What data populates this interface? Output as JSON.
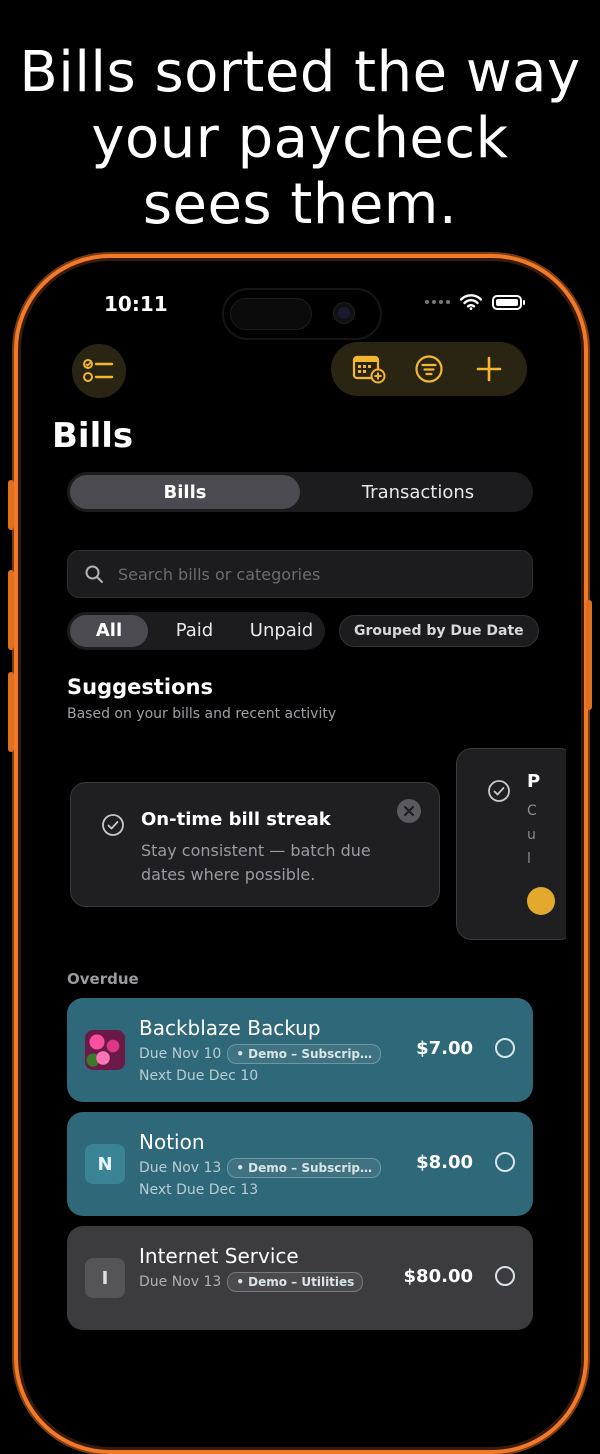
{
  "headline": [
    "Bills sorted the way",
    "your paycheck",
    "sees them."
  ],
  "status": {
    "time": "10:11"
  },
  "page": {
    "title": "Bills"
  },
  "tabs": [
    {
      "label": "Bills",
      "active": true
    },
    {
      "label": "Transactions",
      "active": false
    }
  ],
  "search": {
    "placeholder": "Search bills or categories"
  },
  "filters": [
    {
      "label": "All",
      "active": true
    },
    {
      "label": "Paid",
      "active": false
    },
    {
      "label": "Unpaid",
      "active": false
    }
  ],
  "grouping": {
    "label": "Grouped by Due Date"
  },
  "suggestions": {
    "title": "Suggestions",
    "subtitle": "Based on your bills and recent activity",
    "cards": [
      {
        "title": "On-time bill streak",
        "body": "Stay consistent — batch due dates where possible."
      },
      {
        "title": "P",
        "body_fragments": [
          "C",
          "u",
          "l"
        ]
      }
    ]
  },
  "sections": [
    {
      "label": "Overdue",
      "bills": [
        {
          "name": "Backblaze Backup",
          "due": "Due Nov 10",
          "tag": "• Demo – Subscripti...",
          "next": "Next Due Dec 10",
          "amount": "$7.00",
          "initial": "",
          "style": "teal"
        },
        {
          "name": "Notion",
          "due": "Due Nov 13",
          "tag": "• Demo – Subscriptio...",
          "next": "Next Due Dec 13",
          "amount": "$8.00",
          "initial": "N",
          "style": "teal"
        },
        {
          "name": "Internet Service",
          "due": "Due Nov 13",
          "tag": "• Demo – Utilities",
          "next": "",
          "amount": "$80.00",
          "initial": "I",
          "style": "gray"
        }
      ]
    }
  ],
  "colors": {
    "accent": "#f2b632",
    "frame": "#f07a2a",
    "teal_row": "#2f6878",
    "gray_row": "#3c3c3e"
  }
}
